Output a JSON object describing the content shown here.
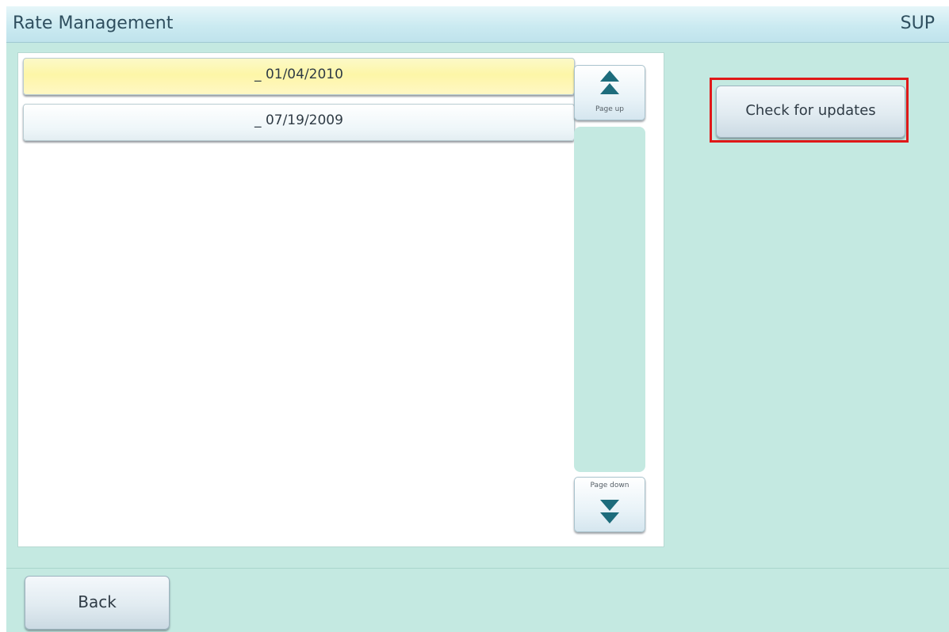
{
  "header": {
    "title": "Rate Management",
    "mode_label": "SUP"
  },
  "rate_list": {
    "items": [
      {
        "label": "_ 01/04/2010",
        "selected": true
      },
      {
        "label": "_ 07/19/2009",
        "selected": false
      }
    ]
  },
  "pager": {
    "page_up_label": "Page up",
    "page_down_label": "Page down"
  },
  "actions": {
    "check_updates_label": "Check for updates"
  },
  "footer": {
    "back_label": "Back"
  },
  "colors": {
    "panel_background": "#c4e9e1",
    "selected_row": "#fdf6a7",
    "arrow": "#1d6c7c",
    "highlight_border": "#e01818"
  }
}
